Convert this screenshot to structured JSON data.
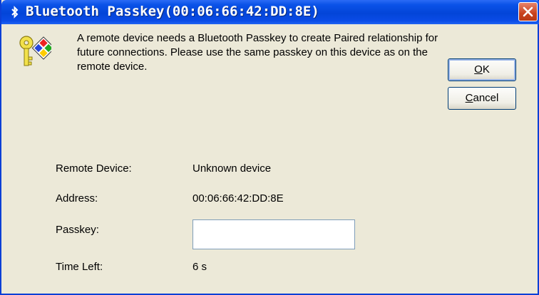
{
  "window": {
    "title": "Bluetooth Passkey(00:06:66:42:DD:8E)",
    "title_icon": "bluetooth-icon",
    "close_icon": "close-icon"
  },
  "message": "A remote device needs a Bluetooth Passkey to create Paired relationship for future connections. Please use the same passkey on this device as on the remote device.",
  "icon": "key-icon",
  "buttons": {
    "ok": "OK",
    "cancel": "Cancel"
  },
  "fields": {
    "remote_device_label": "Remote Device:",
    "remote_device_value": "Unknown device",
    "address_label": "Address:",
    "address_value": "00:06:66:42:DD:8E",
    "passkey_label": "Passkey:",
    "passkey_value": "",
    "time_left_label": "Time Left:",
    "time_left_value": "6 s"
  },
  "colors": {
    "titlebar": "#0a4be6",
    "window_bg": "#ece9d8",
    "close_button": "#c8411d"
  }
}
